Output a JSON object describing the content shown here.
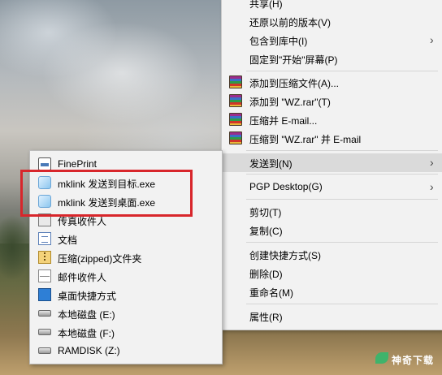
{
  "main_menu": {
    "items": [
      {
        "label": "共享(H)",
        "icon": null,
        "arrow": false
      },
      {
        "label": "还原以前的版本(V)",
        "icon": null,
        "arrow": false
      },
      {
        "label": "包含到库中(I)",
        "icon": null,
        "arrow": true
      },
      {
        "label": "固定到\"开始\"屏幕(P)",
        "icon": null,
        "arrow": false
      },
      {
        "label": "添加到压缩文件(A)...",
        "icon": "winrar-icon",
        "arrow": false
      },
      {
        "label": "添加到 \"WZ.rar\"(T)",
        "icon": "winrar-icon",
        "arrow": false
      },
      {
        "label": "压缩并 E-mail...",
        "icon": "winrar-icon",
        "arrow": false
      },
      {
        "label": "压缩到 \"WZ.rar\" 并 E-mail",
        "icon": "winrar-icon",
        "arrow": false
      },
      {
        "label": "发送到(N)",
        "icon": null,
        "arrow": true,
        "selected": true
      },
      {
        "label": "PGP Desktop(G)",
        "icon": null,
        "arrow": true
      },
      {
        "label": "剪切(T)",
        "icon": null,
        "arrow": false
      },
      {
        "label": "复制(C)",
        "icon": null,
        "arrow": false
      },
      {
        "label": "创建快捷方式(S)",
        "icon": null,
        "arrow": false
      },
      {
        "label": "删除(D)",
        "icon": null,
        "arrow": false
      },
      {
        "label": "重命名(M)",
        "icon": null,
        "arrow": false
      },
      {
        "label": "属性(R)",
        "icon": null,
        "arrow": false
      }
    ],
    "arrow_glyph": "›"
  },
  "send_to_menu": {
    "items": [
      {
        "label": "FinePrint",
        "icon": "printer-icon"
      },
      {
        "label": "mklink 发送到目标.exe",
        "icon": "exe-icon"
      },
      {
        "label": "mklink 发送到桌面.exe",
        "icon": "exe-icon"
      },
      {
        "label": "传真收件人",
        "icon": "fax-icon"
      },
      {
        "label": "文档",
        "icon": "documents-icon"
      },
      {
        "label": "压缩(zipped)文件夹",
        "icon": "zip-folder-icon"
      },
      {
        "label": "邮件收件人",
        "icon": "mail-icon"
      },
      {
        "label": "桌面快捷方式",
        "icon": "desktop-icon"
      },
      {
        "label": "本地磁盘 (E:)",
        "icon": "drive-icon"
      },
      {
        "label": "本地磁盘 (F:)",
        "icon": "drive-icon"
      },
      {
        "label": "RAMDISK (Z:)",
        "icon": "drive-icon"
      }
    ]
  },
  "annotation": {
    "color": "#d8262b"
  },
  "watermark": {
    "text": "神奇下载"
  }
}
